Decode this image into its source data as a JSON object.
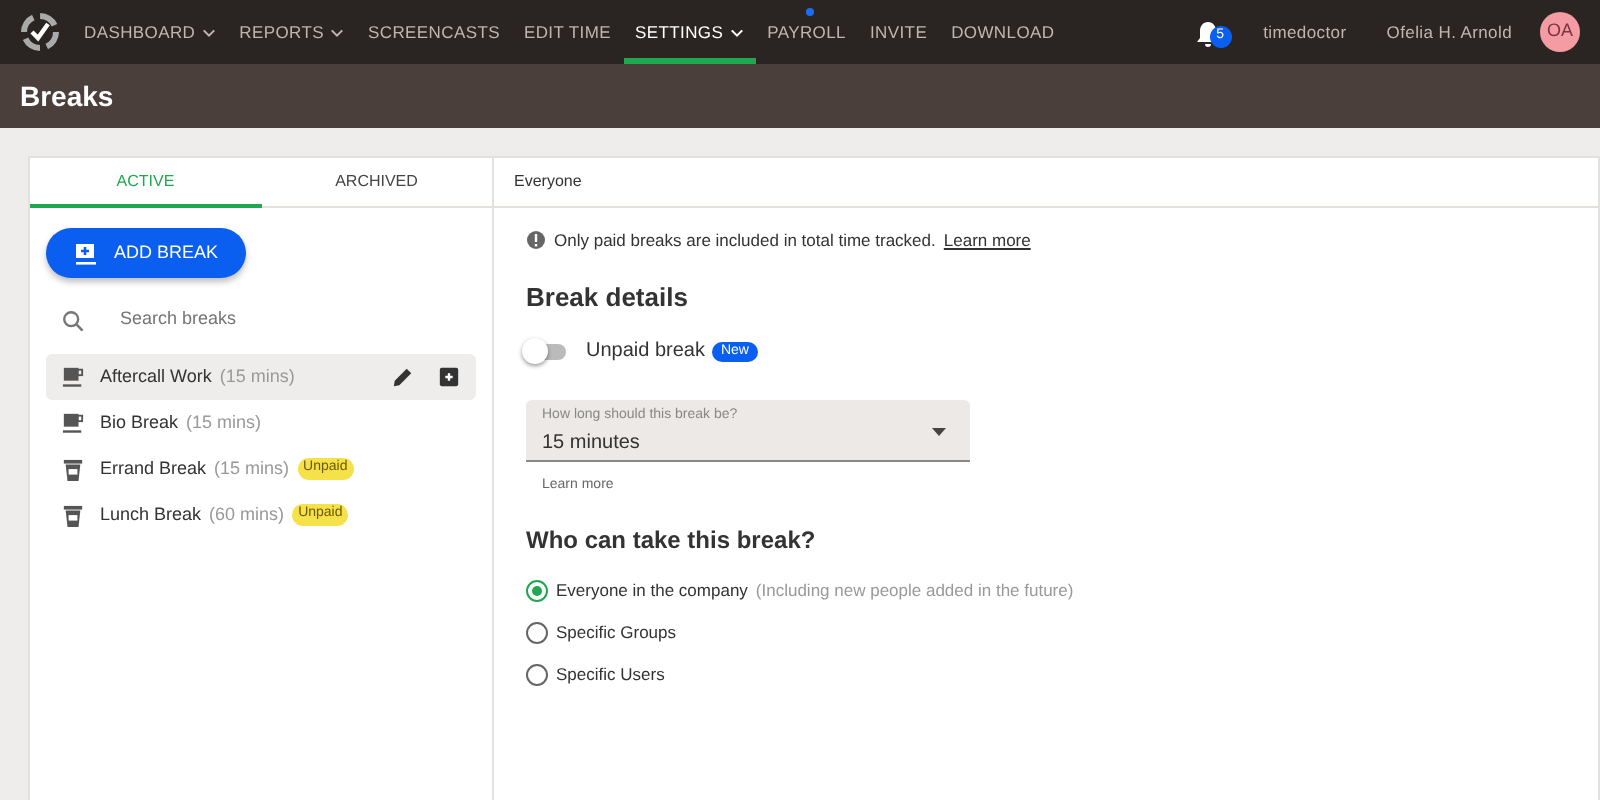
{
  "nav": {
    "items": [
      {
        "label": "DASHBOARD",
        "dropdown": true,
        "selected": false,
        "dot": false
      },
      {
        "label": "REPORTS",
        "dropdown": true,
        "selected": false,
        "dot": false
      },
      {
        "label": "SCREENCASTS",
        "dropdown": false,
        "selected": false,
        "dot": false
      },
      {
        "label": "EDIT TIME",
        "dropdown": false,
        "selected": false,
        "dot": false
      },
      {
        "label": "SETTINGS",
        "dropdown": true,
        "selected": true,
        "dot": false
      },
      {
        "label": "PAYROLL",
        "dropdown": false,
        "selected": false,
        "dot": true
      },
      {
        "label": "INVITE",
        "dropdown": false,
        "selected": false,
        "dot": false
      },
      {
        "label": "DOWNLOAD",
        "dropdown": false,
        "selected": false,
        "dot": false
      }
    ],
    "notifications": "5",
    "company": "timedoctor",
    "user": "Ofelia H. Arnold",
    "avatar": "OA"
  },
  "page_title": "Breaks",
  "tabs": [
    {
      "label": "ACTIVE",
      "selected": true
    },
    {
      "label": "ARCHIVED",
      "selected": false
    }
  ],
  "add_button": "ADD BREAK",
  "search": {
    "placeholder": "Search breaks"
  },
  "breaks": [
    {
      "name": "Aftercall Work",
      "duration": "(15 mins)",
      "kind": "mug",
      "selected": true
    },
    {
      "name": "Bio Break",
      "duration": "(15 mins)",
      "kind": "mug",
      "selected": false
    },
    {
      "name": "Errand Break",
      "duration": "(15 mins)",
      "kind": "cup",
      "badge": "Unpaid",
      "selected": false
    },
    {
      "name": "Lunch Break",
      "duration": "(60 mins)",
      "kind": "cup",
      "badge": "Unpaid",
      "selected": false
    }
  ],
  "detail": {
    "header": "Everyone",
    "info": "Only paid breaks are included in total time tracked.",
    "info_link": "Learn more",
    "section_title": "Break details",
    "unpaid_toggle": {
      "label": "Unpaid break",
      "badge": "New",
      "on": false
    },
    "duration_field": {
      "label": "How long should this break be?",
      "value": "15 minutes"
    },
    "field_link": "Learn more",
    "who_title": "Who can take this break?",
    "options": [
      {
        "label": "Everyone in the company",
        "note": "(Including new people added in the future)",
        "selected": true
      },
      {
        "label": "Specific Groups",
        "selected": false
      },
      {
        "label": "Specific Users",
        "selected": false
      }
    ]
  }
}
